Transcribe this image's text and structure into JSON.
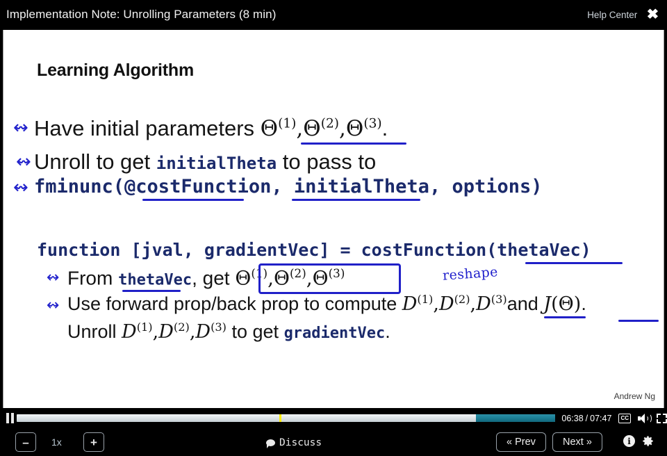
{
  "titlebar": {
    "title": "Implementation Note: Unrolling Parameters (8 min)",
    "help_center": "Help Center",
    "close_icon": "close-x-icon"
  },
  "slide": {
    "heading": "Learning Algorithm",
    "author": "Andrew Ng",
    "arrow_glyph": "↭",
    "lines": {
      "have_prefix": "Have initial parameters ",
      "have_theta1": "Θ",
      "have_sup1": "(1)",
      "have_theta2": "Θ",
      "have_sup2": "(2)",
      "have_theta3": "Θ",
      "have_sup3": "(3)",
      "have_period": ".",
      "unroll_a": "Unroll to get ",
      "unroll_code": "initialTheta",
      "unroll_b": " to pass to",
      "fminunc": "fminunc(@costFunction, initialTheta, options)",
      "function_sig": "function [jval, gradientVec] = costFunction(thetaVec)",
      "from_a": "From ",
      "from_code": "thetaVec",
      "from_b": ",  get ",
      "handwritten_note": "reshape",
      "use_a": "Use forward prop/back prop to compute ",
      "use_and": "and ",
      "use_J": "J",
      "use_Jparen_open": "(",
      "use_Jtheta": "Θ",
      "use_Jparen_close": ")",
      "use_period": ".",
      "unroll2_a": "Unroll ",
      "unroll2_b": " to get ",
      "unroll2_code": "gradientVec",
      "unroll2_period": ".",
      "D_letter": "D",
      "theta_letter": "Θ",
      "sup1": "(1)",
      "sup2": "(2)",
      "sup3": "(3)",
      "comma": ",",
      "annotation_color": "#2020c8"
    }
  },
  "player": {
    "pause_icon": "pause-icon",
    "current_time": "06:38",
    "separator": "/",
    "total_time": "07:47",
    "cc_label": "CC",
    "volume_icon": "volume-icon",
    "fullscreen_icon": "fullscreen-icon",
    "progress_percent": 48.8,
    "buffer_start_percent": 85.3,
    "marker_percent": 48.8,
    "marker_color": "#ffee00",
    "buffer_color": "#1b7f96"
  },
  "toolbar": {
    "speed_minus": "–",
    "speed_label": "1x",
    "speed_plus": "+",
    "discuss_label": "Discuss",
    "prev_label": "« Prev",
    "next_label": "Next »",
    "info_glyph": "i",
    "info_icon": "info-icon",
    "gear_icon": "gear-icon"
  }
}
